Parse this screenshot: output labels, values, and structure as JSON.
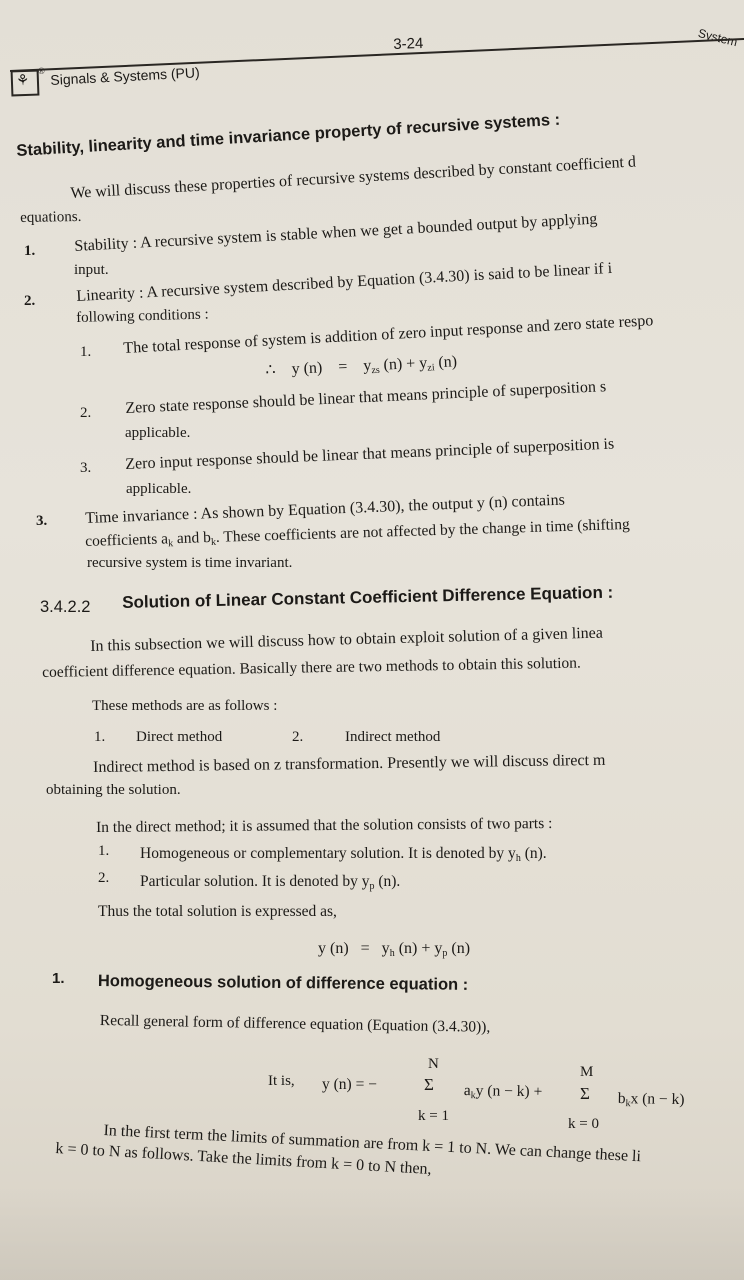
{
  "header": {
    "page_number": "3-24",
    "book_title": "Signals & Systems (PU)",
    "chapter_cut": "System"
  },
  "section": {
    "heading": "Stability, linearity and time invariance property of recursive systems :",
    "intro_l1": "We will discuss these properties of recursive systems described by constant coefficient d",
    "intro_l2": "equations.",
    "items": [
      {
        "num": "1.",
        "l1": "Stability : A recursive system is stable when we get a bounded output by applying",
        "l2": "input."
      },
      {
        "num": "2.",
        "l1": "Linearity : A recursive system described by Equation (3.4.30) is said to be linear if i",
        "l2": "following conditions :"
      }
    ],
    "subitems": [
      {
        "num": "1.",
        "text": "The total response of system is addition of zero input response and zero state respo"
      },
      {
        "num": "2.",
        "l1": "Zero state response should be linear that means principle of superposition s",
        "l2": "applicable."
      },
      {
        "num": "3.",
        "l1": "Zero input response should be linear that means principle of superposition is",
        "l2": "applicable."
      }
    ],
    "eq1": "∴    y (n)    =    y_zs (n) + y_zi (n)",
    "item3": {
      "num": "3.",
      "l1": "Time invariance : As shown by Equation (3.4.30), the output y (n) contains",
      "l2": "coefficients a_k and b_k. These coefficients are not affected by the change in time (shifting",
      "l3": "recursive system is time invariant."
    }
  },
  "subsection": {
    "number": "3.4.2.2",
    "title": "Solution of Linear Constant Coefficient Difference Equation :",
    "p1_l1": "In this subsection we will discuss how to obtain exploit solution of a given linea",
    "p1_l2": "coefficient difference equation. Basically there are two methods to obtain this solution.",
    "p2": "These methods are as follows :",
    "methods": [
      "1.",
      "Direct method",
      "2.",
      "Indirect method"
    ],
    "p3_l1": "Indirect method is based on z transformation. Presently we will discuss direct m",
    "p3_l2": "obtaining the solution.",
    "p4": "In the direct method; it is assumed that the solution consists of two parts :",
    "parts": [
      {
        "num": "1.",
        "text": "Homogeneous or complementary solution. It is denoted by y_h (n)."
      },
      {
        "num": "2.",
        "text": "Particular solution. It is denoted by y_p (n)."
      }
    ],
    "p5": "Thus the total solution is expressed as,",
    "eq2": "y (n)   =   y_h (n) + y_p (n)"
  },
  "homogeneous": {
    "num": "1.",
    "heading": "Homogeneous solution of difference equation :",
    "recall": "Recall general form of difference equation (Equation (3.4.30)),",
    "it_is": "It is,",
    "eq_lhs": "y (n)   =   −",
    "sum1_top": "N",
    "sum1_bot": "k = 1",
    "sum1_term": "a_k y (n − k) +",
    "sum2_top": "M",
    "sum2_bot": "k = 0",
    "sum2_term": "b_k x (n − k)",
    "sigma": "Σ",
    "last_l1": "In the first term the limits of summation are from k = 1 to N. We can change these li",
    "last_l2": "k = 0 to N as follows. Take the limits from k = 0 to N then,"
  }
}
